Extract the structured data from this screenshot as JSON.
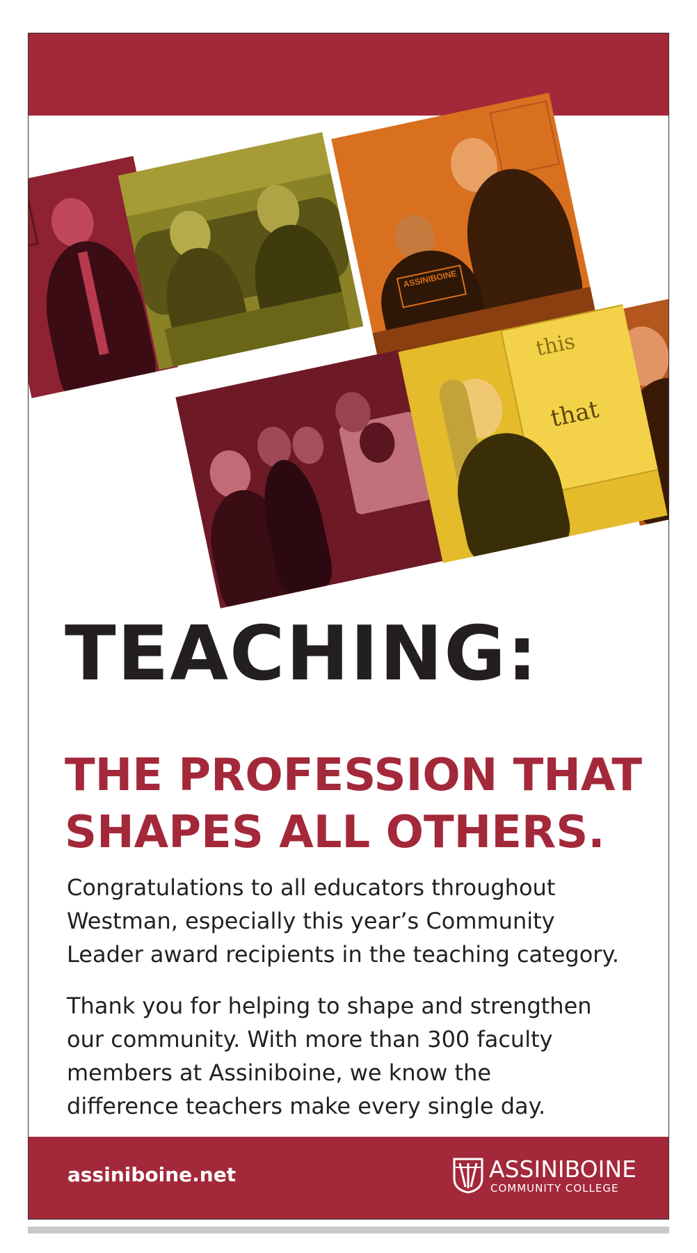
{
  "headline": "TEACHING:",
  "subheadline": {
    "line1": "THE PROFESSION THAT",
    "line2": "SHAPES ALL OTHERS."
  },
  "paragraph1": {
    "line1": "Congratulations to all educators throughout",
    "line2": "Westman, especially this year’s Community",
    "line3": "Leader award recipients in the teaching category."
  },
  "paragraph2": {
    "line1": "Thank you for helping to shape and strengthen",
    "line2": "our community. With more than 300 faculty",
    "line3": "members at Assiniboine, we know the",
    "line4": "difference teachers make every single day."
  },
  "footer": {
    "url": "assiniboine.net",
    "logo_name": "ASSINIBOINE",
    "logo_sub": "COMMUNITY COLLEGE"
  },
  "photos": {
    "whiteboard_word1": "this",
    "whiteboard_word2": "that",
    "sweatshirt_text": "ASSINIBOINE"
  },
  "colors": {
    "brand_red": "#a3283a",
    "headline_black": "#231f20",
    "tile_crimson": "#8e2232",
    "tile_olive": "#8a8227",
    "tile_orange": "#d9701f",
    "tile_maroon": "#6e1a26",
    "tile_gold": "#e3bb2b",
    "tile_rust": "#b4561d"
  }
}
